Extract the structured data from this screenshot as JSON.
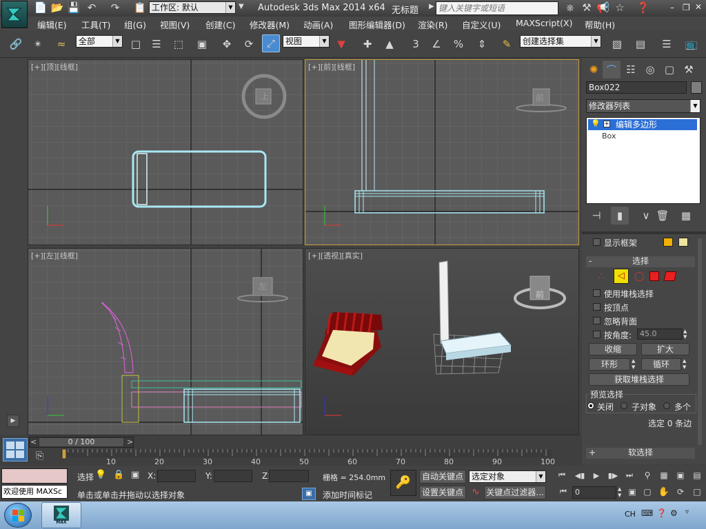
{
  "app": {
    "workspace_label": "工作区: 默认",
    "title": "Autodesk 3ds Max  2014 x64",
    "doc_title": "无标题",
    "search_placeholder": "键入关键字或短语",
    "logo_text": "MAX"
  },
  "menus": [
    "编辑(E)",
    "工具(T)",
    "组(G)",
    "视图(V)",
    "创建(C)",
    "修改器(M)",
    "动画(A)",
    "图形编辑器(D)",
    "渲染(R)",
    "自定义(U)",
    "MAXScript(X)",
    "帮助(H)"
  ],
  "toolbar": {
    "filter_value": "全部",
    "refcoord_value": "视图",
    "selection_set_value": "创建选择集",
    "snap_label": "3"
  },
  "viewports": {
    "top": {
      "label_plus": "[+]",
      "label_view": "[顶]",
      "label_mode": "[线框]",
      "cube_face": "上"
    },
    "front": {
      "label_plus": "[+]",
      "label_view": "[前]",
      "label_mode": "[线框]",
      "cube_face": "前"
    },
    "left": {
      "label_plus": "[+]",
      "label_view": "[左]",
      "label_mode": "[线框]",
      "cube_face": "左"
    },
    "persp": {
      "label_plus": "[+]",
      "label_view": "[透视]",
      "label_mode": "[真实]",
      "cube_face": "前"
    }
  },
  "panel": {
    "object_name": "Box022",
    "modifier_list": "修改器列表",
    "stack_items": [
      "编辑多边形",
      "Box"
    ],
    "show_frame": "显示框架",
    "rollout_select": "选择",
    "use_stack": "使用堆栈选择",
    "by_vertex": "按顶点",
    "ignore_back": "忽略背面",
    "by_angle": "按角度:",
    "angle_value": "45.0",
    "shrink": "收缩",
    "grow": "扩大",
    "ring": "环形",
    "loop": "循环",
    "get_stack_sel": "获取堆栈选择",
    "preview_sel": "预览选择",
    "opt_off": "关闭",
    "opt_sub": "子对象",
    "opt_multi": "多个",
    "selected_info": "选定 0 条边",
    "rollout_soft": "软选择",
    "colors": {
      "swatch1": "#f0b000",
      "swatch2": "#eee6a0",
      "accent": "#2b6fd6"
    }
  },
  "timeline": {
    "frame_counter": "0 / 100",
    "ticks": [
      "10",
      "20",
      "30",
      "40",
      "50",
      "60",
      "70",
      "80",
      "90",
      "100"
    ]
  },
  "status": {
    "welcome": "欢迎使用 MAXSc",
    "select_label": "选择",
    "x_label": "X:",
    "y_label": "Y:",
    "z_label": "Z:",
    "grid": "栅格 = 254.0mm",
    "prompt": "单击或单击并拖动以选择对象",
    "add_time_tag": "添加时间标记",
    "auto_key": "自动关键点",
    "set_key": "设置关键点",
    "key_mode_value": "选定对象",
    "key_filter": "关键点过滤器...",
    "frame_value": "0"
  },
  "taskbar": {
    "lang": "CH"
  }
}
